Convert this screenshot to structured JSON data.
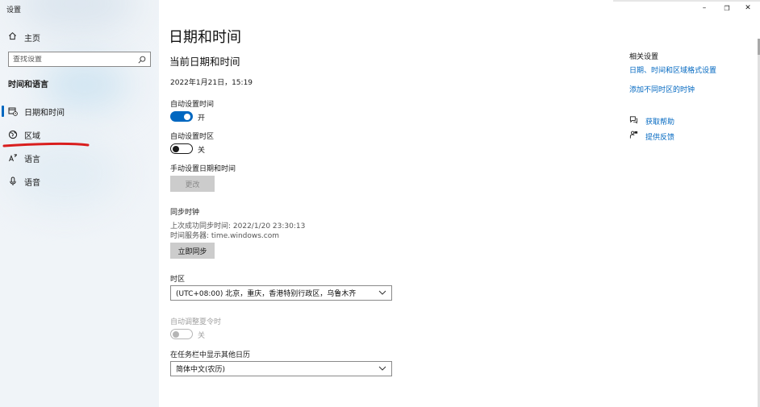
{
  "window": {
    "title": "设置",
    "controls": {
      "minimize": "–",
      "restore": "❐",
      "close": "✕"
    }
  },
  "sidebar": {
    "home_label": "主页",
    "search_placeholder": "查找设置",
    "section_title": "时间和语言",
    "items": [
      {
        "label": "日期和时间",
        "icon": "calendar-clock-icon",
        "selected": true
      },
      {
        "label": "区域",
        "icon": "globe-region-icon",
        "selected": false
      },
      {
        "label": "语言",
        "icon": "language-icon",
        "selected": false
      },
      {
        "label": "语音",
        "icon": "microphone-icon",
        "selected": false
      }
    ]
  },
  "main": {
    "title": "日期和时间",
    "subtitle": "当前日期和时间",
    "current_datetime": "2022年1月21日，15:19",
    "auto_time": {
      "label": "自动设置时间",
      "state": "开",
      "on": true
    },
    "auto_timezone": {
      "label": "自动设置时区",
      "state": "关",
      "on": false
    },
    "manual": {
      "label": "手动设置日期和时间",
      "button": "更改"
    },
    "sync": {
      "title": "同步时钟",
      "last_sync": "上次成功同步时间: 2022/1/20 23:30:13",
      "server": "时间服务器: time.windows.com",
      "button": "立即同步"
    },
    "timezone": {
      "label": "时区",
      "value": "(UTC+08:00) 北京，重庆，香港特别行政区，乌鲁木齐"
    },
    "dst": {
      "label": "自动调整夏令时",
      "state": "关",
      "on": false,
      "disabled": true
    },
    "calendar": {
      "label": "在任务栏中显示其他日历",
      "value": "简体中文(农历)"
    }
  },
  "related": {
    "title": "相关设置",
    "links": [
      "日期、时间和区域格式设置",
      "添加不同时区的时钟"
    ],
    "help": [
      {
        "label": "获取帮助",
        "icon": "help-chat-icon"
      },
      {
        "label": "提供反馈",
        "icon": "feedback-icon"
      }
    ]
  },
  "colors": {
    "accent": "#0067c0",
    "annotation": "#d91e1e",
    "sidebar_bg": "#f0f4f8"
  }
}
